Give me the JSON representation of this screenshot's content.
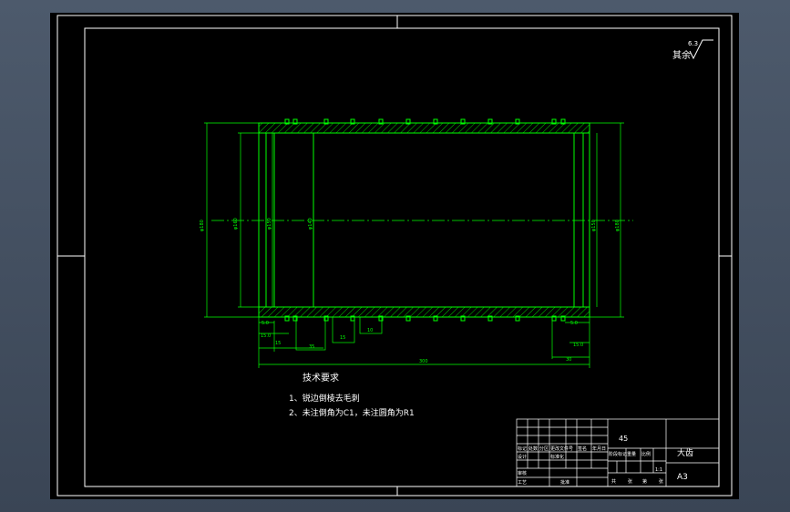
{
  "colors": {
    "background": "#000000",
    "frame": "#ffffff",
    "part": "#00ff00",
    "centerline": "#00ff00",
    "dimension": "#00ff00",
    "text": "#ffffff",
    "chrome": "#4d5a6c"
  },
  "surface_note": {
    "prefix": "其余",
    "roughness": "6.3"
  },
  "tech_requirements": {
    "title": "技术要求",
    "items": [
      "1、锐边倒棱去毛刺",
      "2、未注倒角为C1，未注圆角为R1"
    ]
  },
  "dimensions": {
    "overall_length": "300",
    "diam_1": "φ180",
    "diam_2": "φ160",
    "diam_3": "φ150",
    "diam_4": "φ140",
    "diam_5": "φ150",
    "diam_6": "φ180",
    "d_left_1": "5.0",
    "d_left_2": "15.0",
    "d_left_3": "15",
    "d_left_4": "35",
    "d_mid_1": "15",
    "d_mid_2": "10",
    "d_right_1": "5.0",
    "d_right_2": "15.0",
    "d_right_3": "30"
  },
  "title_block": {
    "material": "45",
    "part_name": "大齿",
    "scale": "1:1",
    "sheet_label": "A3",
    "row_labels": [
      "标记",
      "处数",
      "分区",
      "更改文件号",
      "签名",
      "年月日"
    ],
    "left_labels": [
      "设计",
      "审核",
      "工艺"
    ],
    "mid_labels": [
      "标准化",
      "批准"
    ],
    "stage_labels": [
      "阶段标记",
      "重量",
      "比例"
    ],
    "bottom_labels": [
      "共",
      "张",
      "第",
      "张"
    ]
  }
}
